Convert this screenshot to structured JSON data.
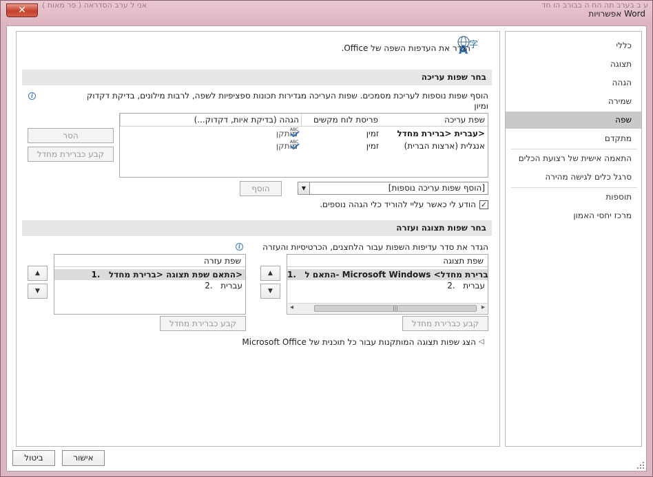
{
  "window": {
    "title": "אפשרויות Word",
    "close_glyph": "✕",
    "bg_text_left": "אני ל  ערב הסדראה ( פר מאות ) ",
    "bg_text_right": "ע ב  בערב  תה הח  ה  בבורב  הו  חד"
  },
  "nav": {
    "items": [
      {
        "label": "כללי"
      },
      {
        "label": "תצוגה"
      },
      {
        "label": "הגהה"
      },
      {
        "label": "שמירה"
      },
      {
        "label": "שפה"
      },
      {
        "label": "מתקדם"
      },
      {
        "label": "התאמה אישית של רצועת הכלים"
      },
      {
        "label": "סרגל כלים לגישה מהירה"
      },
      {
        "label": "תוספות"
      },
      {
        "label": "מרכז יחסי האמון"
      }
    ],
    "selected_index": 4
  },
  "header": {
    "text": "הגדר את העדפות השפה של Office.",
    "icon": "language-globe-icon"
  },
  "editing": {
    "section_title": "בחר שפות עריכה",
    "description_line1": "הוסף שפות נוספות לעריכת מסמכים. שפות העריכה מגדירות תכונות ספציפיות לשפה, לרבות מילונים, בדיקת דקדוק",
    "description_line2": "ומיון",
    "columns": [
      "שפת עריכה",
      "פריסת לוח מקשים",
      "הגהה (בדיקת איות, דקדוק...)"
    ],
    "rows": [
      {
        "language": "עברית <ברירת מחדל>",
        "keyboard": "זמין",
        "proofing": "מותקן"
      },
      {
        "language": "אנגלית (ארצות הברית)",
        "keyboard": "זמין",
        "proofing": "מותקן"
      }
    ],
    "abc_label": "ABC",
    "remove_label": "הסר",
    "set_default_label": "קבע כברירת מחדל",
    "add_dropdown_value": "[הוסף שפות עריכה נוספות]",
    "add_label": "הוסף",
    "notify_checkbox_label": "הודע לי כאשר עליי להוריד כלי הגהה נוספים.",
    "notify_checked": true,
    "check_glyph": "✓"
  },
  "display": {
    "section_title": "בחר שפות תצוגה ועזרה",
    "description": "הגדר את סדר עדיפות השפות עבור הלחצנים, הכרטיסיות והעזרה",
    "display_list": {
      "header": "שפת תצוגה",
      "items": [
        {
          "num": "1.",
          "text": "התאם ל- Microsoft Windows <ברירת מחדל>"
        },
        {
          "num": "2.",
          "text": "עברית"
        }
      ],
      "set_default_label": "קבע כברירת מחדל"
    },
    "help_list": {
      "header": "שפת עזרה",
      "items": [
        {
          "num": "1.",
          "text": "התאם שפת תצוגה <ברירת מחדל>"
        },
        {
          "num": "2.",
          "text": "עברית"
        }
      ],
      "set_default_label": "קבע כברירת מחדל"
    },
    "up_glyph": "▲",
    "down_glyph": "▼",
    "scroll_left_glyph": "◂",
    "scroll_right_glyph": "▸",
    "expander_glyph": "◁",
    "show_installed_label": "הצג שפות תצוגה המותקנות עבור כל תוכנית של Microsoft Office"
  },
  "footer": {
    "ok_label": "אישור",
    "cancel_label": "ביטול"
  },
  "colors": {
    "selected_nav": "#c9c9c9",
    "section_bar": "#e7e7e7",
    "accent_blue": "#3d7ab8"
  }
}
